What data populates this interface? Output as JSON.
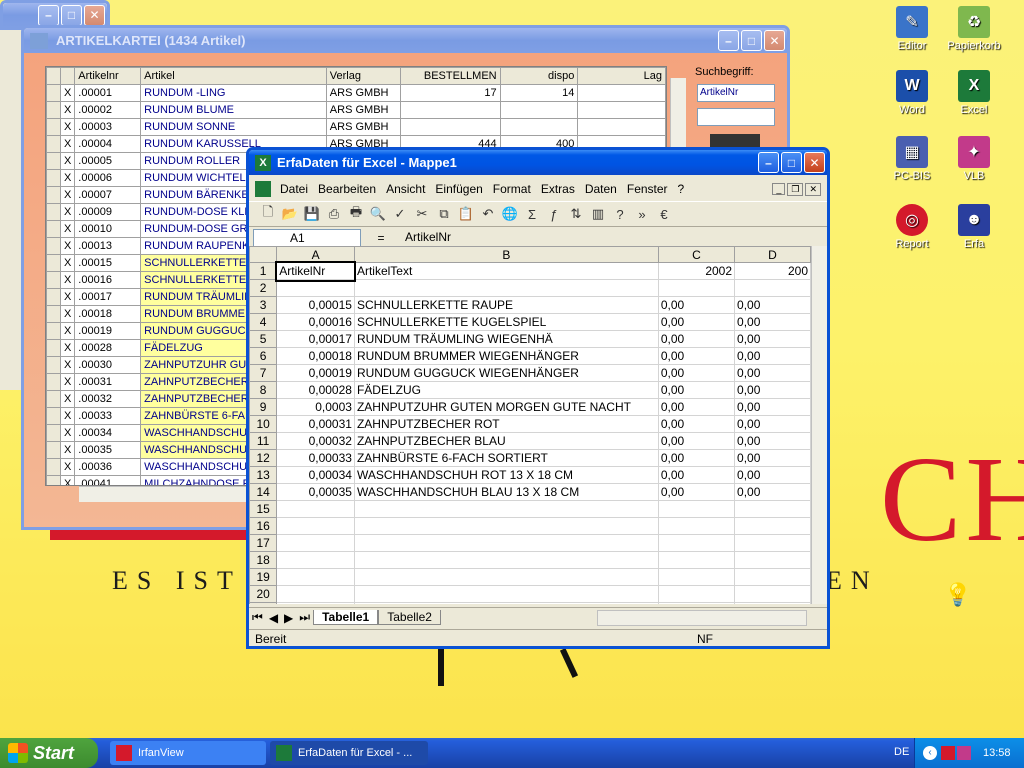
{
  "desktop": {
    "background_text_big": "CH",
    "background_text_line": "ES IST",
    "background_text_line_end": "EN",
    "icons": [
      {
        "label": "Editor",
        "icon": "notepad-icon"
      },
      {
        "label": "Papierkorb",
        "icon": "recycle-bin-icon"
      },
      {
        "label": "Word",
        "icon": "word-icon"
      },
      {
        "label": "Excel",
        "icon": "excel-icon"
      },
      {
        "label": "PC-BIS",
        "icon": "pcbis-icon"
      },
      {
        "label": "VLB",
        "icon": "vlb-icon"
      },
      {
        "label": "Report",
        "icon": "report-icon"
      },
      {
        "label": "Erfa",
        "icon": "erfa-icon"
      }
    ]
  },
  "artikel_window": {
    "title": "ARTIKELKARTEI   (1434 Artikel)",
    "search_label": "Suchbegriff:",
    "search_field_value": "ArtikelNr",
    "search_input_value": "",
    "columns": [
      "Artikelnr",
      "Artikel",
      "Verlag",
      "BESTELLMEN",
      "dispo",
      "Lag"
    ],
    "rows": [
      {
        "mark": "X",
        "nr": ".00001",
        "artikel": "RUNDUM -LING",
        "verlag": "ARS GMBH",
        "bestell": "17",
        "dispo": "14",
        "yellow": false
      },
      {
        "mark": "X",
        "nr": ".00002",
        "artikel": "RUNDUM BLUME",
        "verlag": "ARS GMBH",
        "bestell": "",
        "dispo": "",
        "yellow": false
      },
      {
        "mark": "X",
        "nr": ".00003",
        "artikel": "RUNDUM SONNE",
        "verlag": "ARS GMBH",
        "bestell": "",
        "dispo": "",
        "yellow": false
      },
      {
        "mark": "X",
        "nr": ".00004",
        "artikel": "RUNDUM KARUSSELL",
        "verlag": "ARS GMBH",
        "bestell": "444",
        "dispo": "400",
        "yellow": false
      },
      {
        "mark": "X",
        "nr": ".00005",
        "artikel": "RUNDUM ROLLER",
        "verlag": "",
        "bestell": "",
        "dispo": "",
        "yellow": false
      },
      {
        "mark": "X",
        "nr": ".00006",
        "artikel": "RUNDUM WICHTEL",
        "verlag": "",
        "bestell": "",
        "dispo": "",
        "yellow": false
      },
      {
        "mark": "X",
        "nr": ".00007",
        "artikel": "RUNDUM BÄRENKE",
        "verlag": "",
        "bestell": "",
        "dispo": "",
        "yellow": false
      },
      {
        "mark": "X",
        "nr": ".00009",
        "artikel": "RUNDUM-DOSE KLE",
        "verlag": "",
        "bestell": "",
        "dispo": "",
        "yellow": false
      },
      {
        "mark": "X",
        "nr": ".00010",
        "artikel": "RUNDUM-DOSE GR",
        "verlag": "",
        "bestell": "",
        "dispo": "",
        "yellow": false
      },
      {
        "mark": "X",
        "nr": ".00013",
        "artikel": "RUNDUM RAUPENK",
        "verlag": "",
        "bestell": "",
        "dispo": "",
        "yellow": false
      },
      {
        "mark": "X",
        "nr": ".00015",
        "artikel": "SCHNULLERKETTE",
        "verlag": "",
        "bestell": "",
        "dispo": "",
        "yellow": true
      },
      {
        "mark": "X",
        "nr": ".00016",
        "artikel": "SCHNULLERKETTE",
        "verlag": "",
        "bestell": "",
        "dispo": "",
        "yellow": true
      },
      {
        "mark": "X",
        "nr": ".00017",
        "artikel": "RUNDUM TRÄUMLIN",
        "verlag": "",
        "bestell": "",
        "dispo": "",
        "yellow": true
      },
      {
        "mark": "X",
        "nr": ".00018",
        "artikel": "RUNDUM BRUMMEI",
        "verlag": "",
        "bestell": "",
        "dispo": "",
        "yellow": true
      },
      {
        "mark": "X",
        "nr": ".00019",
        "artikel": "RUNDUM GUGGUCK",
        "verlag": "",
        "bestell": "",
        "dispo": "",
        "yellow": true
      },
      {
        "mark": "X",
        "nr": ".00028",
        "artikel": "FÄDELZUG",
        "verlag": "",
        "bestell": "",
        "dispo": "",
        "yellow": true
      },
      {
        "mark": "X",
        "nr": ".00030",
        "artikel": "ZAHNPUTZUHR GU",
        "verlag": "",
        "bestell": "",
        "dispo": "",
        "yellow": true
      },
      {
        "mark": "X",
        "nr": ".00031",
        "artikel": "ZAHNPUTZBECHER",
        "verlag": "",
        "bestell": "",
        "dispo": "",
        "yellow": true
      },
      {
        "mark": "X",
        "nr": ".00032",
        "artikel": "ZAHNPUTZBECHER",
        "verlag": "",
        "bestell": "",
        "dispo": "",
        "yellow": true
      },
      {
        "mark": "X",
        "nr": ".00033",
        "artikel": "ZAHNBÜRSTE 6-FA",
        "verlag": "",
        "bestell": "",
        "dispo": "",
        "yellow": true
      },
      {
        "mark": "X",
        "nr": ".00034",
        "artikel": "WASCHHANDSCHU",
        "verlag": "",
        "bestell": "",
        "dispo": "",
        "yellow": true
      },
      {
        "mark": "X",
        "nr": ".00035",
        "artikel": "WASCHHANDSCHU",
        "verlag": "",
        "bestell": "",
        "dispo": "",
        "yellow": true
      },
      {
        "mark": "X",
        "nr": ".00036",
        "artikel": "WASCHHANDSCHU",
        "verlag": "",
        "bestell": "",
        "dispo": "",
        "yellow": false
      },
      {
        "mark": "X",
        "nr": ".00041",
        "artikel": "MILCHZAHNDOSE R",
        "verlag": "",
        "bestell": "",
        "dispo": "",
        "yellow": false
      }
    ]
  },
  "excel_window": {
    "title": "ErfaDaten für Excel - Mappe1",
    "menu": [
      "Datei",
      "Bearbeiten",
      "Ansicht",
      "Einfügen",
      "Format",
      "Extras",
      "Daten",
      "Fenster",
      "?"
    ],
    "name_box": "A1",
    "formula_eq": "=",
    "formula_value": "ArtikelNr",
    "col_headers": [
      "A",
      "B",
      "C",
      "D"
    ],
    "rows": [
      {
        "n": "1",
        "a": "ArtikelNr",
        "b": "ArtikelText",
        "c": "2002",
        "d": "200",
        "a_num": false
      },
      {
        "n": "2",
        "a": "",
        "b": "",
        "c": "",
        "d": "",
        "a_num": true
      },
      {
        "n": "3",
        "a": "0,00015",
        "b": "SCHNULLERKETTE RAUPE",
        "c": "0,00",
        "d": "0,00",
        "a_num": true
      },
      {
        "n": "4",
        "a": "0,00016",
        "b": "SCHNULLERKETTE KUGELSPIEL",
        "c": "0,00",
        "d": "0,00",
        "a_num": true
      },
      {
        "n": "5",
        "a": "0,00017",
        "b": "RUNDUM TRÄUMLING WIEGENHÄ",
        "c": "0,00",
        "d": "0,00",
        "a_num": true
      },
      {
        "n": "6",
        "a": "0,00018",
        "b": "RUNDUM BRUMMER WIEGENHÄNGER",
        "c": "0,00",
        "d": "0,00",
        "a_num": true
      },
      {
        "n": "7",
        "a": "0,00019",
        "b": "RUNDUM GUGGUCK WIEGENHÄNGER",
        "c": "0,00",
        "d": "0,00",
        "a_num": true
      },
      {
        "n": "8",
        "a": "0,00028",
        "b": "FÄDELZUG",
        "c": "0,00",
        "d": "0,00",
        "a_num": true
      },
      {
        "n": "9",
        "a": "0,0003",
        "b": "ZAHNPUTZUHR GUTEN MORGEN GUTE NACHT",
        "c": "0,00",
        "d": "0,00",
        "a_num": true
      },
      {
        "n": "10",
        "a": "0,00031",
        "b": "ZAHNPUTZBECHER ROT",
        "c": "0,00",
        "d": "0,00",
        "a_num": true
      },
      {
        "n": "11",
        "a": "0,00032",
        "b": "ZAHNPUTZBECHER BLAU",
        "c": "0,00",
        "d": "0,00",
        "a_num": true
      },
      {
        "n": "12",
        "a": "0,00033",
        "b": "ZAHNBÜRSTE 6-FACH SORTIERT",
        "c": "0,00",
        "d": "0,00",
        "a_num": true
      },
      {
        "n": "13",
        "a": "0,00034",
        "b": "WASCHHANDSCHUH ROT 13 X 18 CM",
        "c": "0,00",
        "d": "0,00",
        "a_num": true
      },
      {
        "n": "14",
        "a": "0,00035",
        "b": "WASCHHANDSCHUH BLAU 13 X 18 CM",
        "c": "0,00",
        "d": "0,00",
        "a_num": true
      },
      {
        "n": "15",
        "a": "",
        "b": "",
        "c": "",
        "d": "",
        "a_num": true
      },
      {
        "n": "16",
        "a": "",
        "b": "",
        "c": "",
        "d": "",
        "a_num": true
      },
      {
        "n": "17",
        "a": "",
        "b": "",
        "c": "",
        "d": "",
        "a_num": true
      },
      {
        "n": "18",
        "a": "",
        "b": "",
        "c": "",
        "d": "",
        "a_num": true
      },
      {
        "n": "19",
        "a": "",
        "b": "",
        "c": "",
        "d": "",
        "a_num": true
      },
      {
        "n": "20",
        "a": "",
        "b": "",
        "c": "",
        "d": "",
        "a_num": true
      },
      {
        "n": "21",
        "a": "",
        "b": "",
        "c": "",
        "d": "",
        "a_num": true
      }
    ],
    "sheet_tabs": [
      "Tabelle1",
      "Tabelle2"
    ],
    "status": "Bereit",
    "status_nf": "NF"
  },
  "taskbar": {
    "start_label": "Start",
    "tasks": [
      {
        "label": "IrfanView",
        "icon": "irfanview-icon",
        "active": false
      },
      {
        "label": "ErfaDaten für Excel - ...",
        "icon": "excel-icon",
        "active": true
      }
    ],
    "lang": "DE",
    "clock": "13:58"
  },
  "colors": {
    "xp_blue": "#0054e3",
    "desktop_yellow": "#fdf26a",
    "brand_red": "#d4192b",
    "row_yellow": "#ffff9e",
    "link_blue": "#00008b"
  }
}
